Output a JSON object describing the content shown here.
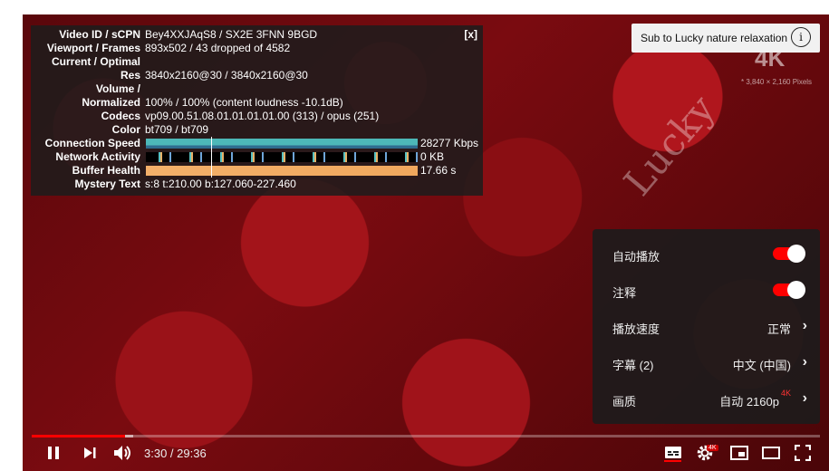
{
  "video_bg": {
    "script_text": "Lucky",
    "badge": "4K",
    "badge_sub": "* 3,840 × 2,160 Pixels"
  },
  "stats": {
    "close_label": "[x]",
    "rows": [
      {
        "label": "Video ID / sCPN",
        "value": "Bey4XXJAqS8 / SX2E 3FNN 9BGD"
      },
      {
        "label": "Viewport / Frames",
        "value": "893x502 / 43 dropped of 4582"
      },
      {
        "label": "Current / Optimal",
        "value": ""
      },
      {
        "label": "Res",
        "value": "3840x2160@30 / 3840x2160@30"
      },
      {
        "label": "Volume /",
        "value": ""
      },
      {
        "label": "Normalized",
        "value": "100% / 100% (content loudness -10.1dB)"
      },
      {
        "label": "Codecs",
        "value": "vp09.00.51.08.01.01.01.01.00 (313) / opus (251)"
      },
      {
        "label": "Color",
        "value": "bt709 / bt709"
      },
      {
        "label": "Connection Speed",
        "value": "28277 Kbps"
      },
      {
        "label": "Network Activity",
        "value": "0 KB"
      },
      {
        "label": "Buffer Health",
        "value": "17.66 s"
      },
      {
        "label": "Mystery Text",
        "value": "s:8 t:210.00 b:127.060-227.460"
      }
    ]
  },
  "subscribe": {
    "label": "Sub to Lucky nature relaxation",
    "info_icon": "i"
  },
  "settings_menu": {
    "autoplay": {
      "label": "自动播放",
      "on": true
    },
    "annotations": {
      "label": "注释",
      "on": true
    },
    "speed": {
      "label": "播放速度",
      "value": "正常"
    },
    "subtitles": {
      "label": "字幕 (2)",
      "value": "中文 (中国)"
    },
    "quality": {
      "label": "画质",
      "value": "自动 2160p",
      "badge": "4K"
    }
  },
  "controls": {
    "time_current": "3:30",
    "time_separator": " / ",
    "time_total": "29:36",
    "progress_played_fraction": 0.1182,
    "play_pause_icon": "pause-icon",
    "next_icon": "next-icon",
    "volume_icon": "volume-icon",
    "subtitles_icon": "subtitles-icon",
    "settings_icon": "settings-icon",
    "settings_badge": "4K",
    "miniplayer_icon": "miniplayer-icon",
    "theater_icon": "theater-icon",
    "fullscreen_icon": "fullscreen-icon"
  },
  "colors": {
    "accent": "#ff0000",
    "panel_bg": "#1c1c1c"
  }
}
